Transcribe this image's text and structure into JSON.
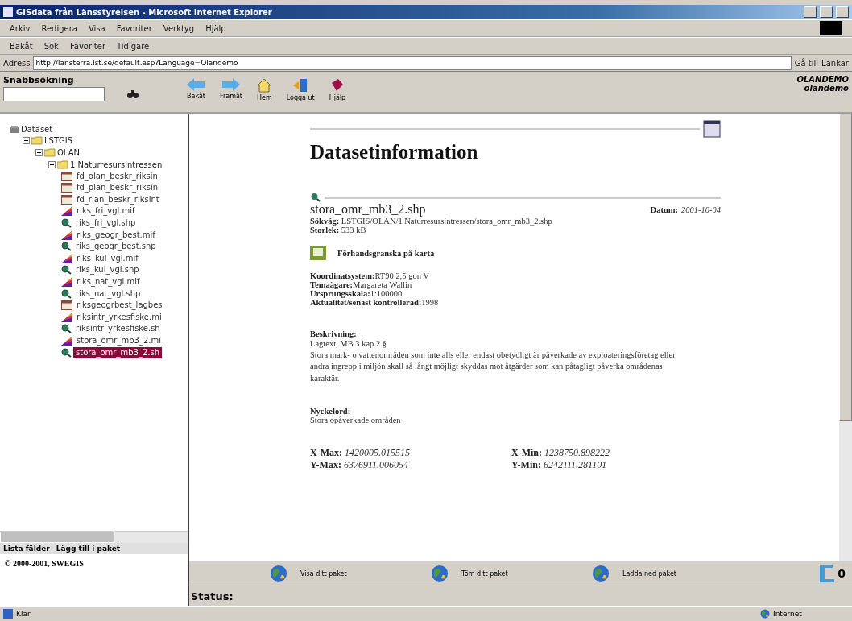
{
  "window": {
    "title": "GISdata från Länsstyrelsen - Microsoft Internet Explorer"
  },
  "menu": [
    "Arkiv",
    "Redigera",
    "Visa",
    "Favoriter",
    "Verktyg",
    "Hjälp"
  ],
  "toolbar": {
    "back": "Bakåt",
    "search": "Sök",
    "favorites": "Favoriter",
    "history": "Tidigare"
  },
  "address": {
    "label": "Adress",
    "value": "http://lansterra.lst.se/default.asp?Language=Olandemo",
    "go": "Gå till",
    "links": "Länkar"
  },
  "app_header": {
    "search_label": "Snabbsökning",
    "nav": [
      "Bakåt",
      "Framåt",
      "Hem",
      "Logga ut",
      "Hjälp"
    ],
    "user": "OLANDEMO",
    "login": "olandemo"
  },
  "tree": [
    {
      "label": "Dataset",
      "kind": "root",
      "children": [
        {
          "label": "LSTGIS",
          "kind": "folder",
          "expanded": true,
          "children": [
            {
              "label": "OLAN",
              "kind": "folder",
              "expanded": true,
              "children": [
                {
                  "label": "1 Naturresursintressen",
                  "kind": "folder",
                  "expanded": true,
                  "children": [
                    {
                      "label": "fd_olan_beskr_riksin",
                      "kind": "table",
                      "selected": false
                    },
                    {
                      "label": "fd_plan_beskr_riksin",
                      "kind": "table",
                      "selected": false
                    },
                    {
                      "label": "fd_rlan_beskr_riksint",
                      "kind": "table",
                      "selected": false
                    },
                    {
                      "label": "riks_fri_vgl.mif",
                      "kind": "mif",
                      "selected": false
                    },
                    {
                      "label": "riks_fri_vgl.shp",
                      "kind": "shp",
                      "selected": false
                    },
                    {
                      "label": "riks_geogr_best.mif",
                      "kind": "mif",
                      "selected": false
                    },
                    {
                      "label": "riks_geogr_best.shp",
                      "kind": "shp",
                      "selected": false
                    },
                    {
                      "label": "riks_kul_vgl.mif",
                      "kind": "mif",
                      "selected": false
                    },
                    {
                      "label": "riks_kul_vgl.shp",
                      "kind": "shp",
                      "selected": false
                    },
                    {
                      "label": "riks_nat_vgl.mif",
                      "kind": "mif",
                      "selected": false
                    },
                    {
                      "label": "riks_nat_vgl.shp",
                      "kind": "shp",
                      "selected": false
                    },
                    {
                      "label": "riksgeogrbest_lagbes",
                      "kind": "table",
                      "selected": false
                    },
                    {
                      "label": "riksintr_yrkesfiske.mi",
                      "kind": "mif",
                      "selected": false
                    },
                    {
                      "label": "riksintr_yrkesfiske.sh",
                      "kind": "shp",
                      "selected": false
                    },
                    {
                      "label": "stora_omr_mb3_2.mi",
                      "kind": "mif",
                      "selected": false
                    },
                    {
                      "label": "stora_omr_mb3_2.sh",
                      "kind": "shp",
                      "selected": true
                    }
                  ]
                }
              ]
            }
          ]
        }
      ]
    }
  ],
  "tree_actions": [
    "Lista fälder",
    "Lägg till i paket"
  ],
  "copyright": "© 2000-2001, SWEGIS",
  "content": {
    "heading": "Datasetinformation",
    "file": "stora_omr_mb3_2.shp",
    "date": {
      "label": "Datum:",
      "value": "2001-10-04"
    },
    "path": {
      "label": "Sökväg:",
      "value": "LSTGIS/OLAN/1 Naturresursintressen/stora_omr_mb3_2.shp"
    },
    "size": {
      "label": "Storlek:",
      "value": "533 kB"
    },
    "preview": "Förhandsgranska på karta",
    "properties": [
      {
        "label": "Koordinatsystem:",
        "value": "RT90 2,5 gon V"
      },
      {
        "label": "Temaägare:",
        "value": "Margareta Wallin"
      },
      {
        "label": "Ursprungsskala:",
        "value": "1:100000"
      },
      {
        "label": "Aktualitet/senast kontrollerad:",
        "value": "1998"
      }
    ],
    "description": {
      "label": "Beskrivning:",
      "lines": [
        "Lagtext, MB 3 kap 2 §",
        "Stora mark- o vattenområden som inte alls eller endast obetydligt är påverkade av exploateringsföretag eller andra ingrepp i miljön skall så långt möjligt skyddas mot åtgärder som kan påtagligt påverka områdenas karaktär."
      ]
    },
    "keywords": {
      "label": "Nyckelord:",
      "value": "Stora opåverkade områden"
    },
    "extent": [
      {
        "label": "X-Max:",
        "value": "1420005.015515"
      },
      {
        "label": "X-Min:",
        "value": "1238750.898222"
      },
      {
        "label": "Y-Max:",
        "value": "6376911.006054"
      },
      {
        "label": "Y-Min:",
        "value": "6242111.281101"
      }
    ]
  },
  "package_bar": {
    "buttons": [
      "Visa ditt paket",
      "Töm ditt paket",
      "Ladda ned paket"
    ],
    "count": "0"
  },
  "status": {
    "label": "Status:"
  },
  "ie_status": {
    "text": "Klar",
    "zone": "Internet"
  }
}
